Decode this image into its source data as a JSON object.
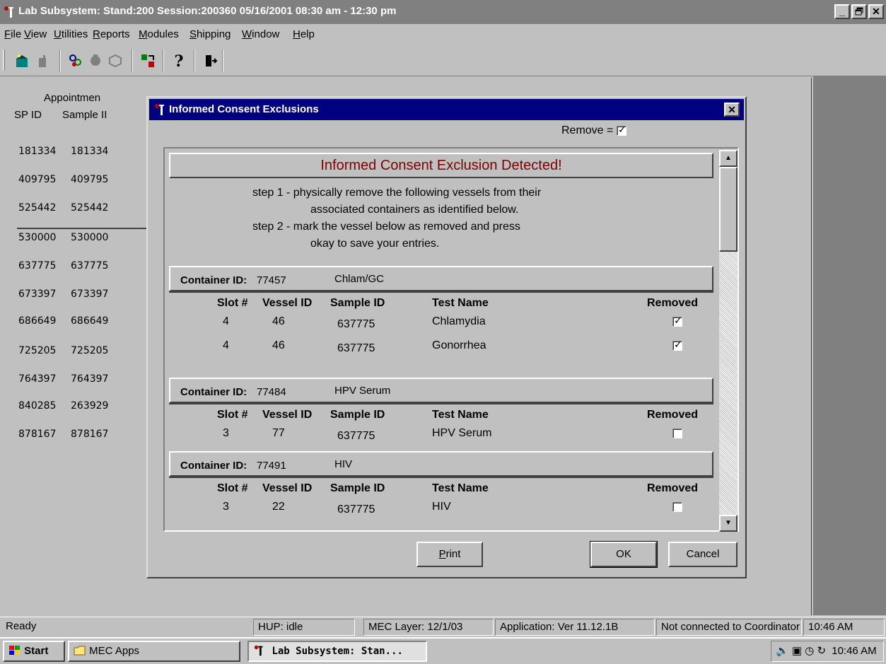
{
  "window": {
    "title": "Lab Subsystem: Stand:200 Session:200360 05/16/2001 08:30 am - 12:30 pm",
    "minimize": "_",
    "restore": "▫",
    "close": "✕"
  },
  "menu": [
    {
      "label": "File",
      "u": "F",
      "rest": "ile"
    },
    {
      "label": "View",
      "u": "V",
      "rest": "iew"
    },
    {
      "label": "Utilities",
      "u": "U",
      "rest": "tilities"
    },
    {
      "label": "Reports",
      "u": "R",
      "rest": "eports"
    },
    {
      "label": "Modules",
      "u": "M",
      "rest": "odules"
    },
    {
      "label": "Shipping",
      "u": "S",
      "rest": "hipping"
    },
    {
      "label": "Window",
      "u": "W",
      "rest": "indow"
    },
    {
      "label": "Help",
      "u": "H",
      "rest": "elp"
    }
  ],
  "toolbar": {
    "icons": [
      "new-icon",
      "open-icon",
      "people-icon",
      "stop-icon",
      "print-icon",
      "transfer-icon",
      "help-icon",
      "exit-icon"
    ]
  },
  "sp_list": {
    "header_line1": "Appointmen",
    "col_spid": "SP ID",
    "col_sample": "Sample II",
    "rows": [
      {
        "spid": "181334",
        "sample": "181334"
      },
      {
        "spid": "409795",
        "sample": "409795"
      },
      {
        "spid": "525442",
        "sample": "525442"
      },
      {
        "spid": "530000",
        "sample": "530000"
      },
      {
        "spid": "637775",
        "sample": "637775"
      },
      {
        "spid": "673397",
        "sample": "673397"
      },
      {
        "spid": "686649",
        "sample": "686649"
      },
      {
        "spid": "725205",
        "sample": "725205"
      },
      {
        "spid": "764397",
        "sample": "764397"
      },
      {
        "spid": "840285",
        "sample": "263929"
      },
      {
        "spid": "878167",
        "sample": "878167"
      }
    ]
  },
  "dialog": {
    "title": "Informed Consent Exclusions",
    "close": "✕",
    "remove_legend": "Remove =",
    "banner": "Informed Consent Exclusion Detected!",
    "step1_a": "step 1 -  physically remove the following vessels from their",
    "step1_b": "associated containers as identified below.",
    "step2_a": "step 2 -  mark the vessel below as removed and press",
    "step2_b": "okay to save your entries.",
    "container_label": "Container ID:",
    "col_slot": "Slot #",
    "col_vessel": "Vessel ID",
    "col_sample": "Sample ID",
    "col_test": "Test Name",
    "col_removed": "Removed",
    "containers": [
      {
        "id": "77457",
        "name": "Chlam/GC",
        "rows": [
          {
            "slot": "4",
            "vessel": "46",
            "sample": "637775",
            "test": "Chlamydia",
            "removed": true
          },
          {
            "slot": "4",
            "vessel": "46",
            "sample": "637775",
            "test": "Gonorrhea",
            "removed": true
          }
        ]
      },
      {
        "id": "77484",
        "name": "HPV Serum",
        "rows": [
          {
            "slot": "3",
            "vessel": "77",
            "sample": "637775",
            "test": "HPV Serum",
            "removed": false
          }
        ]
      },
      {
        "id": "77491",
        "name": "HIV",
        "rows": [
          {
            "slot": "3",
            "vessel": "22",
            "sample": "637775",
            "test": "HIV",
            "removed": false
          }
        ]
      }
    ],
    "print_u": "P",
    "print_rest": "rint",
    "ok": "OK",
    "cancel": "Cancel"
  },
  "statusbar": {
    "ready": "Ready",
    "hup": "HUP: idle",
    "mec": "MEC Layer: 12/1/03",
    "app": "Application: Ver 11.12.1B",
    "coord": "Not connected to Coordinator",
    "time": "10:46 AM"
  },
  "taskbar": {
    "start": "Start",
    "mec_apps": "MEC Apps",
    "lab": "Lab Subsystem: Stan...",
    "clock": "10:46 AM"
  },
  "colors": {
    "title_active": "#000080",
    "title_inactive": "#808080",
    "banner_text": "#800000",
    "face": "#c0c0c0"
  }
}
